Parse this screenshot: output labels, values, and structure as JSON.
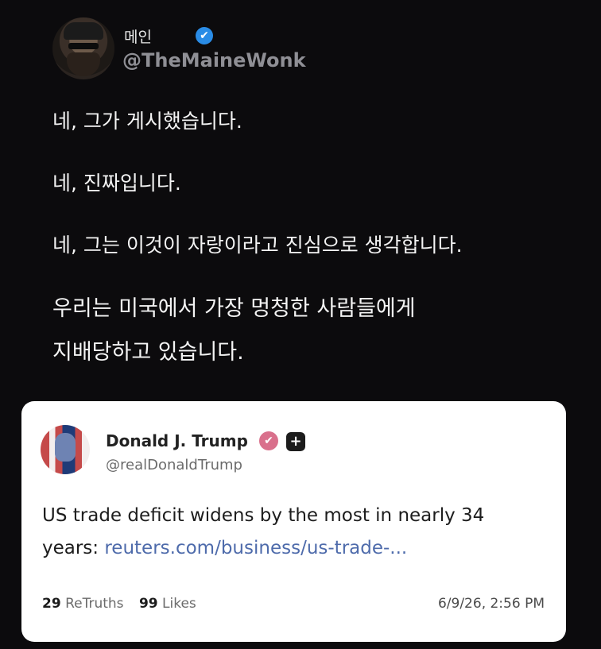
{
  "author": {
    "name": "메인",
    "handle": "@TheMaineWonk",
    "verified_icon": "✔"
  },
  "post": {
    "lines": [
      "네, 그가 게시했습니다.",
      "네, 진짜입니다.",
      "네, 그는 이것이 자랑이라고 진심으로 생각합니다.",
      "우리는 미국에서 가장 멍청한 사람들에게",
      "지배당하고 있습니다."
    ]
  },
  "quoted": {
    "name": "Donald J. Trump",
    "handle": "@realDonaldTrump",
    "badge_icon": "✔",
    "plus_icon": "+",
    "text": "US trade deficit widens by the most in nearly 34 years: ",
    "link": "reuters.com/business/us-trade-...",
    "retruths_count": "29",
    "retruths_label": "ReTruths",
    "likes_count": "99",
    "likes_label": "Likes",
    "timestamp": "6/9/26, 2:56 PM"
  },
  "colors": {
    "background": "#0c0b0d",
    "verified_blue": "#2a8ce6",
    "link_blue": "#4e6bab",
    "badge_pink": "#d9708c"
  }
}
